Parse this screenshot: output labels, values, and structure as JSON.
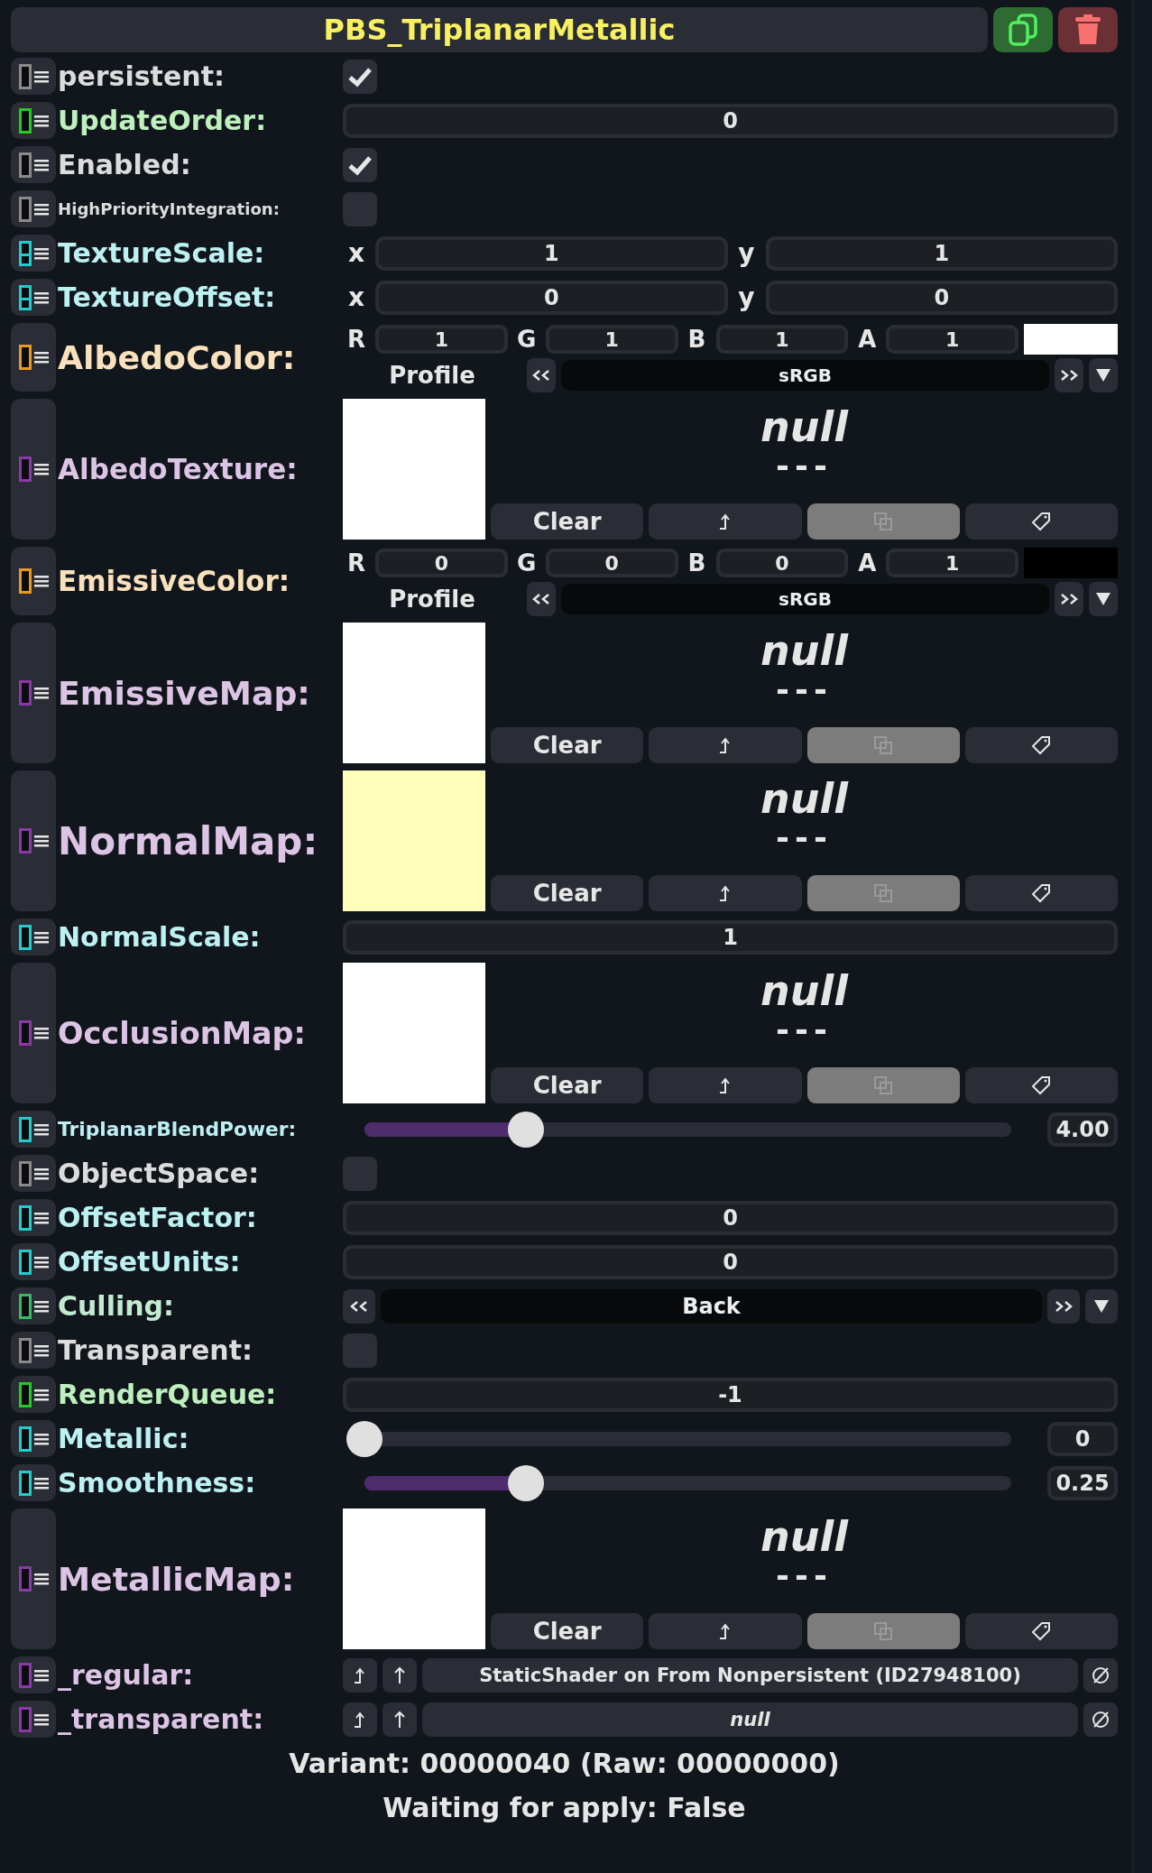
{
  "title": "PBS_TriplanarMetallic",
  "fields": [
    {
      "kind": "checkbox",
      "label": "persistent:",
      "color": "#8a8a8a",
      "checked": true
    },
    {
      "kind": "number",
      "label": "UpdateOrder:",
      "color": "#22cc22",
      "value": "0"
    },
    {
      "kind": "checkbox",
      "label": "Enabled:",
      "color": "#8a8a8a",
      "checked": true
    },
    {
      "kind": "checkbox",
      "label": "HighPriorityIntegration:",
      "color": "#8a8a8a",
      "checked": false
    },
    {
      "kind": "vector",
      "label": "TextureScale:",
      "color": "#22cccc",
      "components": [
        {
          "axis": "x",
          "value": "1"
        },
        {
          "axis": "y",
          "value": "1"
        }
      ]
    },
    {
      "kind": "vector",
      "label": "TextureOffset:",
      "color": "#22cccc",
      "components": [
        {
          "axis": "x",
          "value": "0"
        },
        {
          "axis": "y",
          "value": "0"
        }
      ]
    },
    {
      "kind": "color",
      "label": "AlbedoColor:",
      "color": "#e89a20",
      "channels": [
        {
          "name": "R",
          "value": "1"
        },
        {
          "name": "G",
          "value": "1"
        },
        {
          "name": "B",
          "value": "1"
        },
        {
          "name": "A",
          "value": "1"
        }
      ],
      "swatch": {
        "color": "#ffffff"
      },
      "profile_label": "Profile",
      "profile": "sRGB"
    },
    {
      "kind": "texture",
      "label": "AlbedoTexture:",
      "color": "#8a3aa8",
      "preview": {
        "color": "#ffffff"
      },
      "asset": "null",
      "asset_detail": "---",
      "clear_label": "Clear"
    },
    {
      "kind": "color",
      "label": "EmissiveColor:",
      "color": "#e89a20",
      "channels": [
        {
          "name": "R",
          "value": "0"
        },
        {
          "name": "G",
          "value": "0"
        },
        {
          "name": "B",
          "value": "0"
        },
        {
          "name": "A",
          "value": "1"
        }
      ],
      "swatch": {
        "color": "#000000"
      },
      "profile_label": "Profile",
      "profile": "sRGB"
    },
    {
      "kind": "texture",
      "label": "EmissiveMap:",
      "color": "#8a3aa8",
      "preview": {
        "color": "#ffffff"
      },
      "asset": "null",
      "asset_detail": "---",
      "clear_label": "Clear"
    },
    {
      "kind": "texture",
      "label": "NormalMap:",
      "color": "#8a3aa8",
      "preview": {
        "color": "#ffffbb"
      },
      "asset": "null",
      "asset_detail": "---",
      "clear_label": "Clear"
    },
    {
      "kind": "number",
      "label": "NormalScale:",
      "color": "#22cccc",
      "value": "1"
    },
    {
      "kind": "texture",
      "label": "OcclusionMap:",
      "color": "#8a3aa8",
      "preview": {
        "color": "#ffffff"
      },
      "asset": "null",
      "asset_detail": "---",
      "clear_label": "Clear"
    },
    {
      "kind": "slider",
      "label": "TriplanarBlendPower:",
      "color": "#22cccc",
      "level": 0.25,
      "reading": "4.00"
    },
    {
      "kind": "checkbox",
      "label": "ObjectSpace:",
      "color": "#8a8a8a",
      "checked": false
    },
    {
      "kind": "number",
      "label": "OffsetFactor:",
      "color": "#22cccc",
      "value": "0"
    },
    {
      "kind": "number",
      "label": "OffsetUnits:",
      "color": "#22cccc",
      "value": "0"
    },
    {
      "kind": "enum",
      "label": "Culling:",
      "color": "#33bb66",
      "value": "Back"
    },
    {
      "kind": "checkbox",
      "label": "Transparent:",
      "color": "#8a8a8a",
      "checked": false
    },
    {
      "kind": "number",
      "label": "RenderQueue:",
      "color": "#22cc22",
      "value": "-1"
    },
    {
      "kind": "slider",
      "label": "Metallic:",
      "color": "#22cccc",
      "level": 0,
      "reading": "0"
    },
    {
      "kind": "slider",
      "label": "Smoothness:",
      "color": "#22cccc",
      "level": 0.25,
      "reading": "0.25"
    },
    {
      "kind": "texture",
      "label": "MetallicMap:",
      "color": "#8a3aa8",
      "preview": {
        "color": "#ffffff"
      },
      "asset": "null",
      "asset_detail": "---",
      "clear_label": "Clear"
    },
    {
      "kind": "reference",
      "label": "_regular:",
      "color": "#8a3aa8",
      "target": "StaticShader on From Nonpersistent (ID27948100)",
      "empty": false
    },
    {
      "kind": "reference",
      "label": "_transparent:",
      "color": "#8a3aa8",
      "target": "null",
      "empty": true
    }
  ],
  "footer": [
    "Variant: 00000040 (Raw: 00000000)",
    "Waiting for apply: False"
  ]
}
